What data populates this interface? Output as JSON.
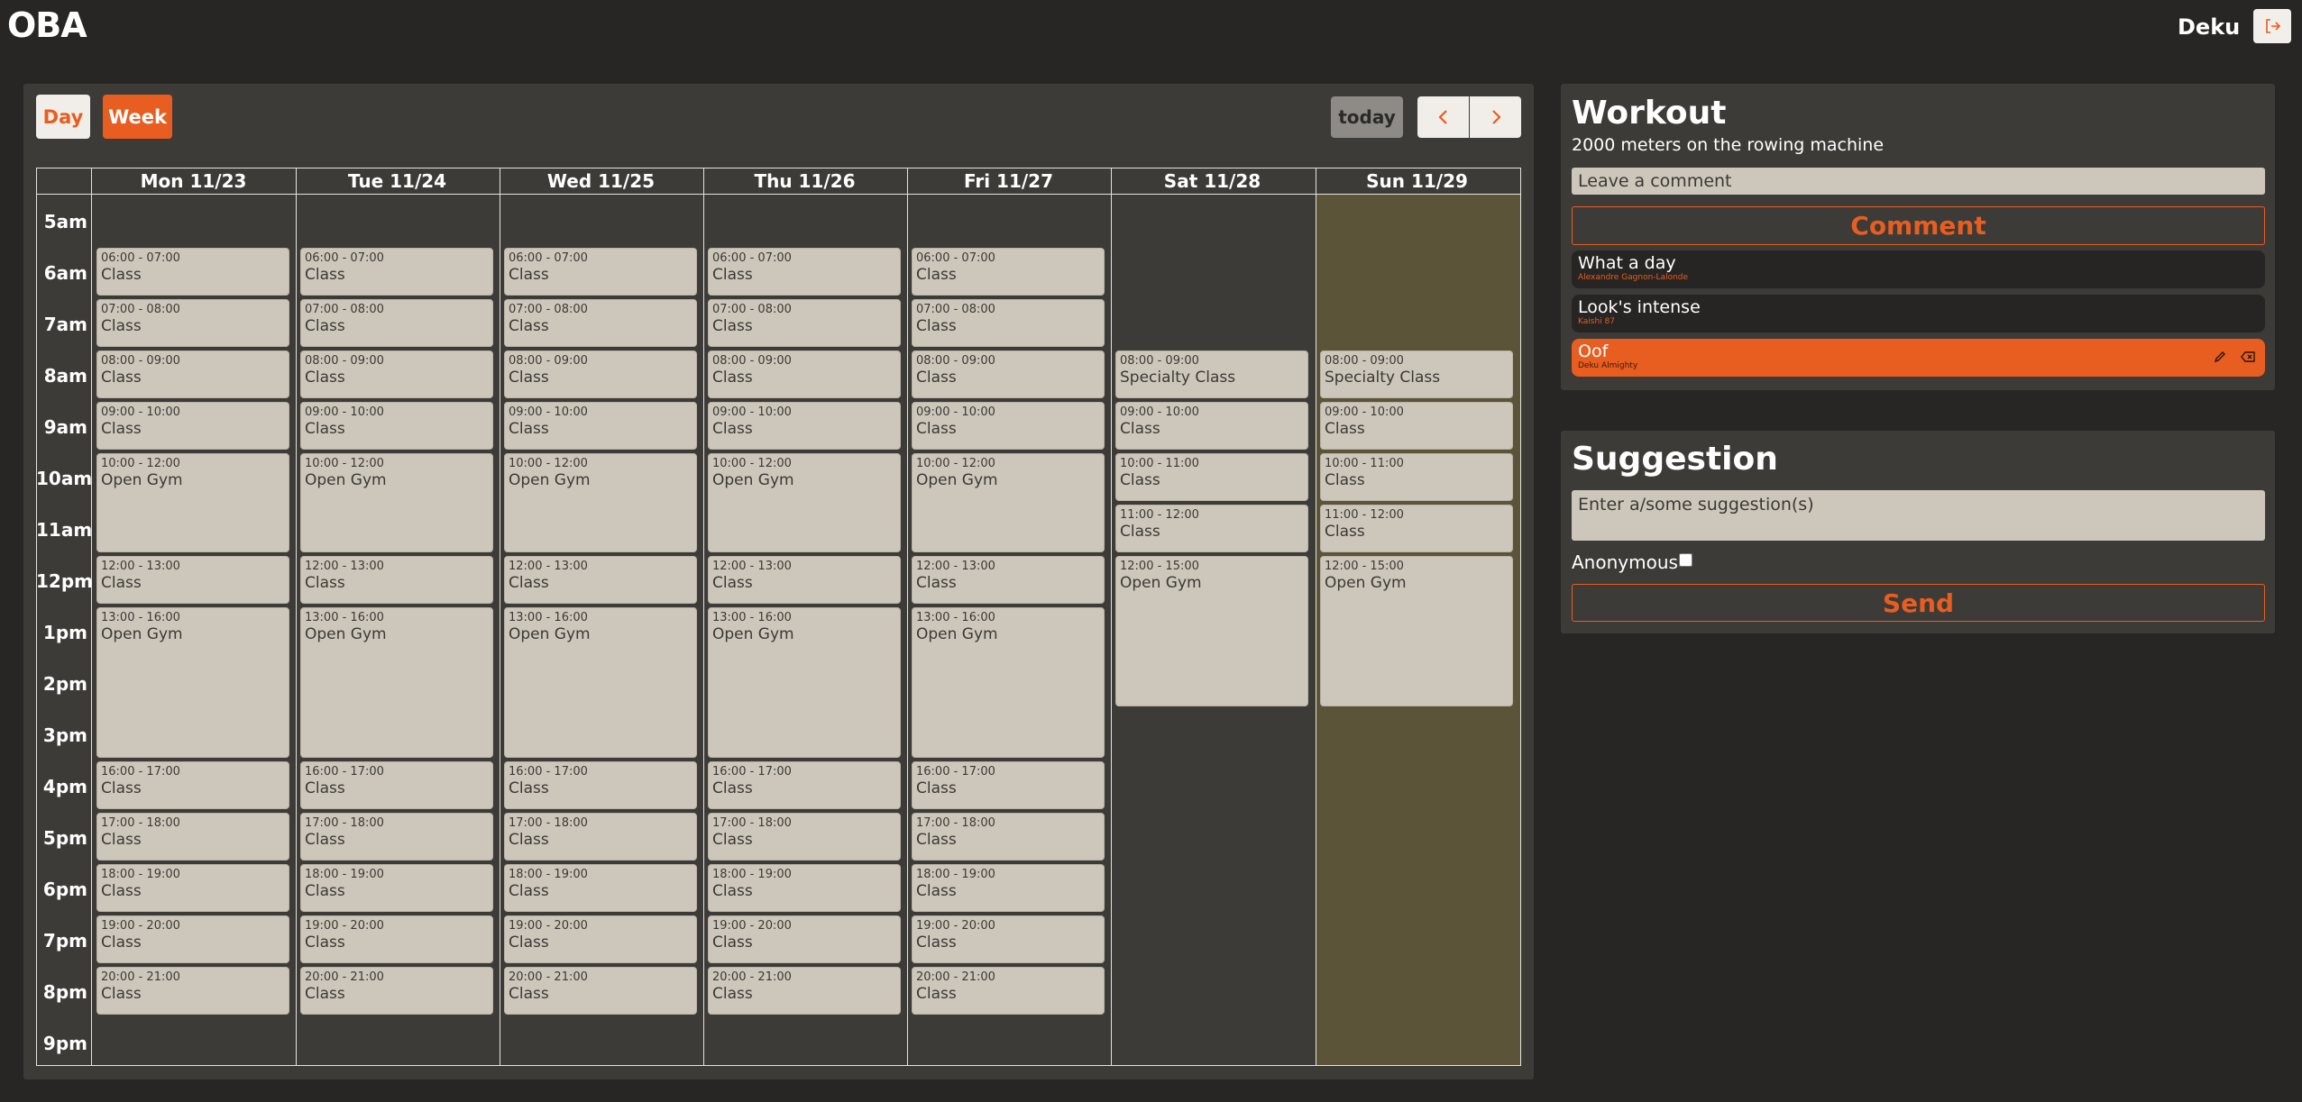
{
  "header": {
    "brand": "OBA",
    "username": "Deku",
    "logout_icon": "logout-icon"
  },
  "toolbar": {
    "day_label": "Day",
    "week_label": "Week",
    "today_label": "today",
    "prev_icon": "chevron-left-icon",
    "next_icon": "chevron-right-icon"
  },
  "calendar": {
    "days": [
      "Mon 11/23",
      "Tue 11/24",
      "Wed 11/25",
      "Thu 11/26",
      "Fri 11/27",
      "Sat 11/28",
      "Sun 11/29"
    ],
    "hours": [
      "5am",
      "6am",
      "7am",
      "8am",
      "9am",
      "10am",
      "11am",
      "12pm",
      "1pm",
      "2pm",
      "3pm",
      "4pm",
      "5pm",
      "6pm",
      "7pm",
      "8pm",
      "9pm"
    ],
    "weekday_events": [
      {
        "start": 6,
        "end": 7,
        "time": "06:00 - 07:00",
        "title": "Class"
      },
      {
        "start": 7,
        "end": 8,
        "time": "07:00 - 08:00",
        "title": "Class"
      },
      {
        "start": 8,
        "end": 9,
        "time": "08:00 - 09:00",
        "title": "Class"
      },
      {
        "start": 9,
        "end": 10,
        "time": "09:00 - 10:00",
        "title": "Class"
      },
      {
        "start": 10,
        "end": 12,
        "time": "10:00 - 12:00",
        "title": "Open Gym"
      },
      {
        "start": 12,
        "end": 13,
        "time": "12:00 - 13:00",
        "title": "Class"
      },
      {
        "start": 13,
        "end": 16,
        "time": "13:00 - 16:00",
        "title": "Open Gym"
      },
      {
        "start": 16,
        "end": 17,
        "time": "16:00 - 17:00",
        "title": "Class"
      },
      {
        "start": 17,
        "end": 18,
        "time": "17:00 - 18:00",
        "title": "Class"
      },
      {
        "start": 18,
        "end": 19,
        "time": "18:00 - 19:00",
        "title": "Class"
      },
      {
        "start": 19,
        "end": 20,
        "time": "19:00 - 20:00",
        "title": "Class"
      },
      {
        "start": 20,
        "end": 21,
        "time": "20:00 - 21:00",
        "title": "Class"
      }
    ],
    "weekend_events": [
      {
        "start": 8,
        "end": 9,
        "time": "08:00 - 09:00",
        "title": "Specialty Class"
      },
      {
        "start": 9,
        "end": 10,
        "time": "09:00 - 10:00",
        "title": "Class"
      },
      {
        "start": 10,
        "end": 11,
        "time": "10:00 - 11:00",
        "title": "Class"
      },
      {
        "start": 11,
        "end": 12,
        "time": "11:00 - 12:00",
        "title": "Class"
      },
      {
        "start": 12,
        "end": 15,
        "time": "12:00 - 15:00",
        "title": "Open Gym"
      }
    ],
    "today_highlight_color": "#5c5438"
  },
  "workout": {
    "title": "Workout",
    "description": "2000 meters on the rowing machine",
    "comment_placeholder": "Leave a comment",
    "comment_button": "Comment",
    "comments": [
      {
        "text": "What a day",
        "author": "Alexandre Gagnon-Lalonde",
        "mine": false
      },
      {
        "text": "Look's intense",
        "author": "Kaishi 87",
        "mine": false
      },
      {
        "text": "Oof",
        "author": "Deku Almighty",
        "mine": true
      }
    ],
    "edit_icon": "pencil-icon",
    "delete_icon": "backspace-icon"
  },
  "suggestion": {
    "title": "Suggestion",
    "placeholder": "Enter a/some suggestion(s)",
    "anonymous_label": "Anonymous",
    "send_button": "Send"
  },
  "colors": {
    "accent": "#e85d20",
    "background": "#282624",
    "panel": "#3d3b38",
    "event": "#cdc7bb"
  }
}
